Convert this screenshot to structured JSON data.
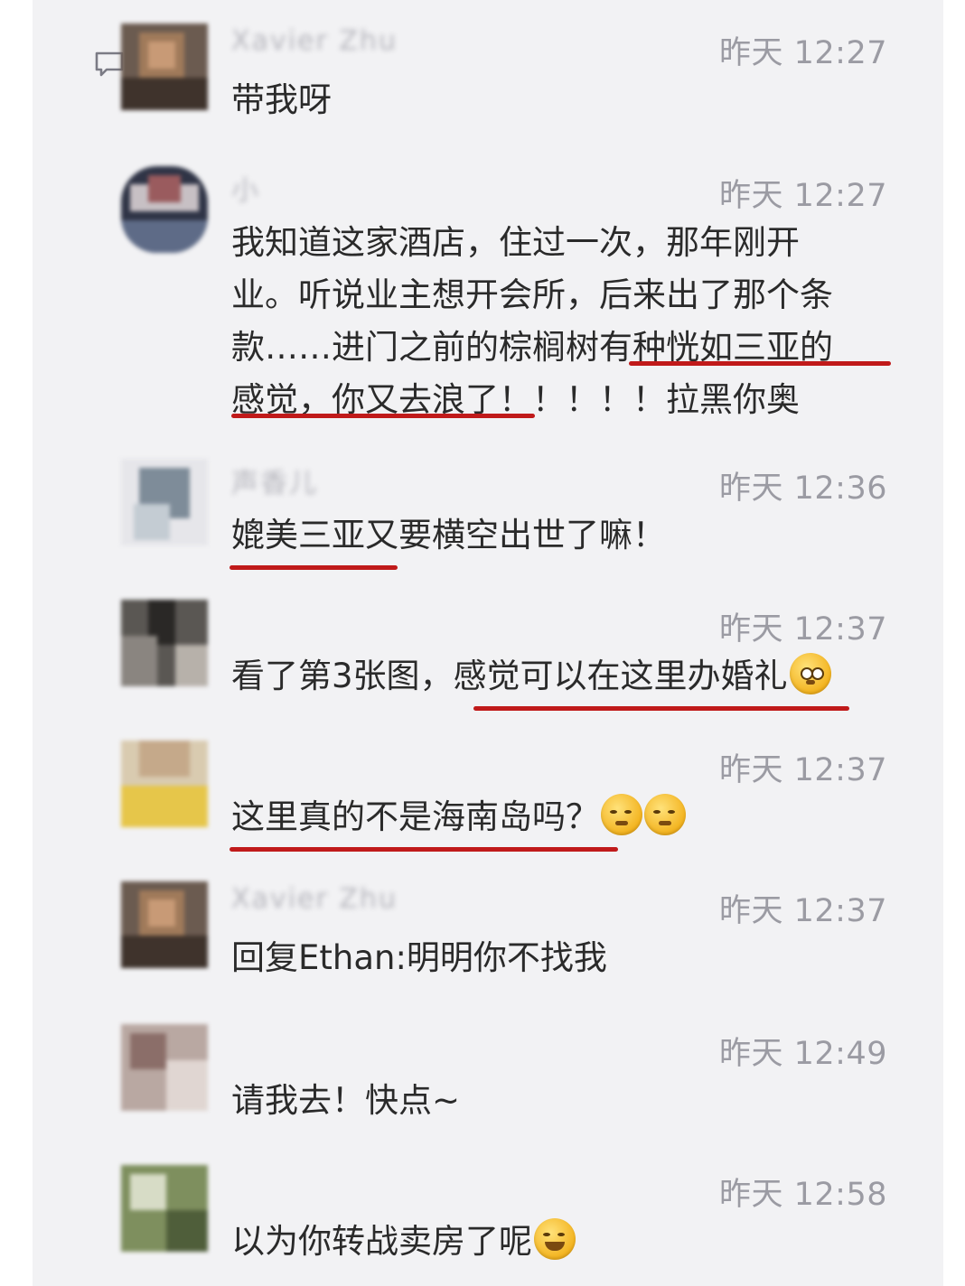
{
  "icons": {
    "comment": "comment-icon"
  },
  "colors": {
    "underline": "#c01a1a",
    "time": "#9b9ba3",
    "panel": "#f2f2f4"
  },
  "messages": [
    {
      "name": "Xavier Zhu",
      "time": "昨天 12:27",
      "text": "带我呀",
      "emoji": []
    },
    {
      "name": "小",
      "time": "昨天 12:27",
      "lines": [
        "我知道这家酒店，住过一次，那年刚开",
        "业。听说业主想开会所，后来出了那个条",
        "款……进门之前的棕榈树有种恍如三亚的",
        "感觉，你又去浪了！！！！！拉黑你奥"
      ],
      "emoji": []
    },
    {
      "name": "声香儿",
      "time": "昨天 12:36",
      "text": "媲美三亚又要横空出世了嘛！",
      "emoji": []
    },
    {
      "name": "",
      "time": "昨天 12:37",
      "text": "看了第3张图，感觉可以在这里办婚礼",
      "emoji": [
        "flushed-emoji"
      ]
    },
    {
      "name": "",
      "time": "昨天 12:37",
      "text": "这里真的不是海南岛吗？",
      "emoji": [
        "smirk-emoji",
        "smirk-emoji"
      ]
    },
    {
      "name": "Xavier Zhu",
      "time": "昨天 12:37",
      "text": "回复Ethan:明明你不找我",
      "emoji": []
    },
    {
      "name": "",
      "time": "昨天 12:49",
      "text": "请我去！快点~",
      "emoji": []
    },
    {
      "name": "",
      "time": "昨天 12:58",
      "text": "以为你转战卖房了呢",
      "emoji": [
        "laughing-crying-emoji"
      ]
    }
  ]
}
